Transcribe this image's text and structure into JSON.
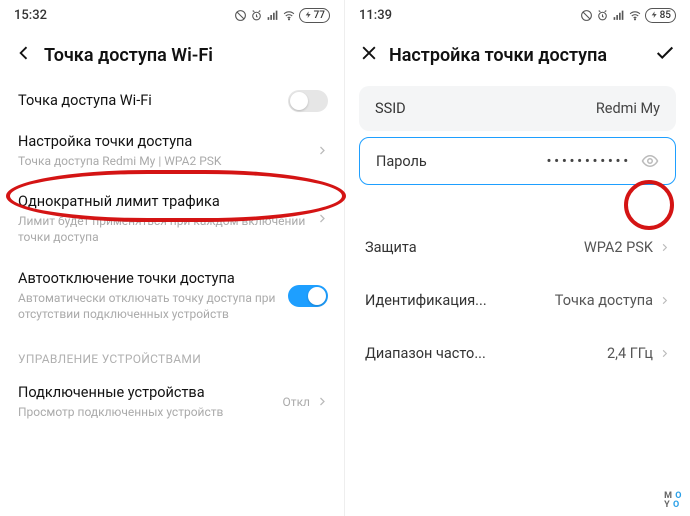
{
  "left": {
    "time": "15:32",
    "battery": "77",
    "title": "Точка доступа Wi-Fi",
    "rows": {
      "hotspot": {
        "title": "Точка доступа Wi-Fi"
      },
      "setup": {
        "title": "Настройка точки доступа",
        "sub": "Точка доступа Redmi My | WPA2 PSK"
      },
      "limit": {
        "title": "Однократный лимит трафика",
        "sub": "Лимит будет применяться при каждом включении точки доступа"
      },
      "auto_off": {
        "title": "Автоотключение точки доступа",
        "sub": "Автоматически отключать точку доступа при отсутствии подключенных устройств"
      },
      "section": "УПРАВЛЕНИЕ УСТРОЙСТВАМИ",
      "devices": {
        "title": "Подключенные устройства",
        "sub": "Просмотр подключенных устройств",
        "value": "Откл"
      }
    }
  },
  "right": {
    "time": "11:39",
    "battery": "85",
    "title": "Настройка точки доступа",
    "ssid": {
      "label": "SSID",
      "value": "Redmi My"
    },
    "password": {
      "label": "Пароль",
      "value": "•••••••••••"
    },
    "security": {
      "label": "Защита",
      "value": "WPA2 PSK"
    },
    "ident": {
      "label": "Идентификация...",
      "value": "Точка доступа"
    },
    "band": {
      "label": "Диапазон часто...",
      "value": "2,4 ГГц"
    }
  },
  "logo": {
    "l1": "M O",
    "l2": "Y O"
  }
}
